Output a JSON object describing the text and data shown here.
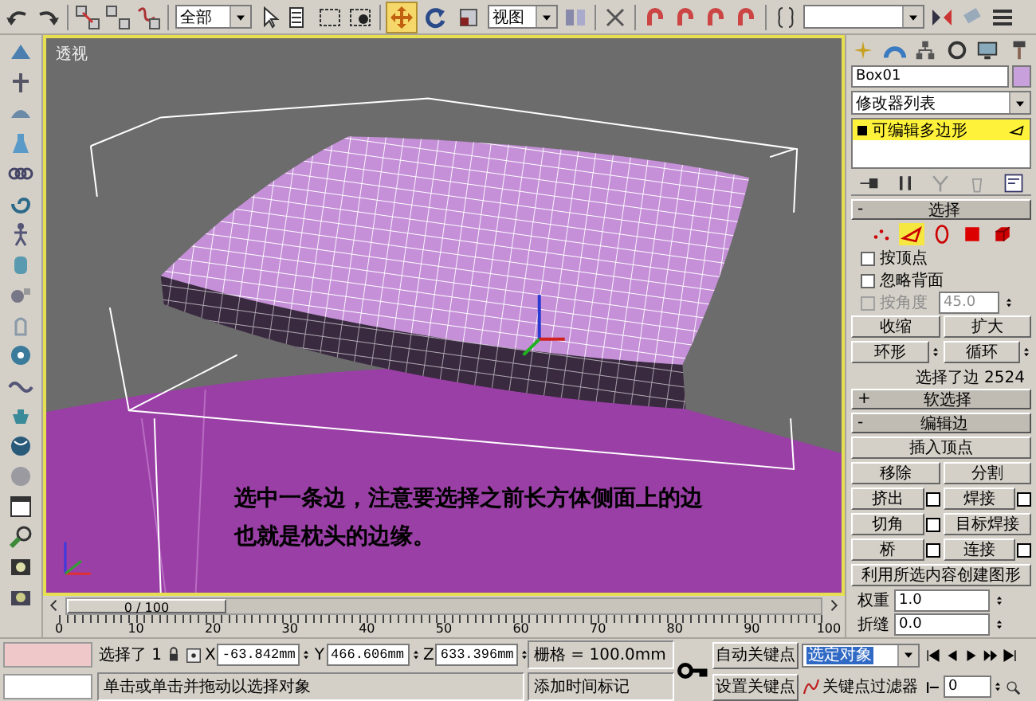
{
  "toolbar": {
    "selection_filter": "全部",
    "tools": [
      {
        "selected": true
      },
      {
        "selected": false
      },
      {
        "selected": false
      }
    ],
    "reference_coord": "视图"
  },
  "viewport": {
    "label": "透视",
    "caption": [
      "选中一条边，注意要选择之前长方体侧面上的边",
      "也就是枕头的边缘。"
    ]
  },
  "command_panel": {
    "object_name": "Box01",
    "modifier_list": "修改器列表",
    "stack": [
      {
        "label": "可编辑多边形",
        "selected": true
      }
    ],
    "selection": {
      "title": "选择",
      "sign": "-",
      "levels": [
        {
          "selected": false
        },
        {
          "selected": true
        },
        {
          "selected": false
        },
        {
          "selected": false
        },
        {
          "selected": false
        }
      ],
      "checkboxes": [
        {
          "label": "按顶点",
          "checked": false,
          "disabled": false
        },
        {
          "label": "忽略背面",
          "checked": false,
          "disabled": false
        },
        {
          "label": "按角度",
          "checked": false,
          "disabled": true,
          "value": "45.0"
        }
      ],
      "buttons": [
        {
          "label": "收缩",
          "kind": "plain"
        },
        {
          "label": "扩大",
          "kind": "plain"
        },
        {
          "label": "环形",
          "kind": "spinner"
        },
        {
          "label": "循环",
          "kind": "spinner"
        }
      ],
      "status": "选择了边 2524"
    },
    "soft_selection": {
      "title": "软选择",
      "sign": "+"
    },
    "edit_edges": {
      "title": "编辑边",
      "sign": "-",
      "buttons": [
        {
          "label": "插入顶点",
          "kind": "wide"
        },
        {
          "label": "移除",
          "kind": "plain"
        },
        {
          "label": "分割",
          "kind": "plain"
        },
        {
          "label": "挤出",
          "kind": "settings"
        },
        {
          "label": "焊接",
          "kind": "settings"
        },
        {
          "label": "切角",
          "kind": "settings"
        },
        {
          "label": "目标焊接",
          "kind": "plain"
        },
        {
          "label": "桥",
          "kind": "settings"
        },
        {
          "label": "连接",
          "kind": "settings"
        },
        {
          "label": "利用所选内容创建图形",
          "kind": "wide"
        }
      ],
      "fields": [
        {
          "label": "权重",
          "value": "1.0"
        },
        {
          "label": "折缝",
          "value": "0.0"
        }
      ]
    }
  },
  "time_slider": {
    "label": "0 / 100",
    "level": 0
  },
  "ruler": {
    "labels": [
      "0",
      "10",
      "20",
      "30",
      "40",
      "50",
      "60",
      "70",
      "80",
      "90",
      "100"
    ]
  },
  "status_bar": {
    "selection": "选择了 1",
    "coords": [
      {
        "axis": "X",
        "value": "-63.842mm"
      },
      {
        "axis": "Y",
        "value": "466.606mm"
      },
      {
        "axis": "Z",
        "value": "633.396mm"
      }
    ],
    "grid": "栅格 = 100.0mm",
    "prompt": "单击或单击并拖动以选择对象",
    "time_tag": "添加时间标记",
    "auto_key": "自动关键点",
    "set_key": "设置关键点",
    "key_mode": "选定对象",
    "key_filters": "关键点过滤器",
    "frame": "0"
  }
}
